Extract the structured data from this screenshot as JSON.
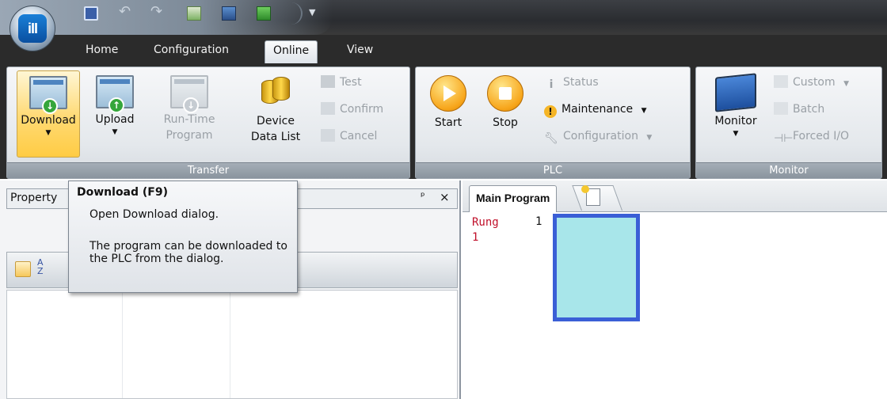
{
  "tabs": [
    "Home",
    "Configuration",
    "Online",
    "View"
  ],
  "active_tab": "Online",
  "transfer_group": {
    "label": "Transfer",
    "download": "Download",
    "upload": "Upload",
    "runtime_1": "Run-Time",
    "runtime_2": "Program",
    "device_1": "Device",
    "device_2": "Data List",
    "test": "Test",
    "confirm": "Confirm",
    "cancel": "Cancel"
  },
  "plc_group": {
    "label": "PLC",
    "start": "Start",
    "stop": "Stop",
    "status": "Status",
    "maintenance": "Maintenance",
    "configuration": "Configuration"
  },
  "monitor_group": {
    "label": "Monitor",
    "monitor": "Monitor",
    "custom": "Custom",
    "batch": "Batch",
    "forced_io": "Forced I/O"
  },
  "property_panel": {
    "title": "Property",
    "pin": "ᵖ",
    "close": "×"
  },
  "tooltip": {
    "title": "Download (F9)",
    "line1": "Open Download dialog.",
    "line2": "The program can be downloaded to the PLC from the dialog."
  },
  "editor": {
    "tab_main": "Main Program",
    "rung_label": "Rung",
    "rung_number_top": "1",
    "rung_number_left": "1"
  },
  "colors": {
    "accent_selected": "#ffd972",
    "rung_text": "#c0102a",
    "cursor_border": "#3a5fd6",
    "cursor_fill": "#a8e6ea"
  }
}
